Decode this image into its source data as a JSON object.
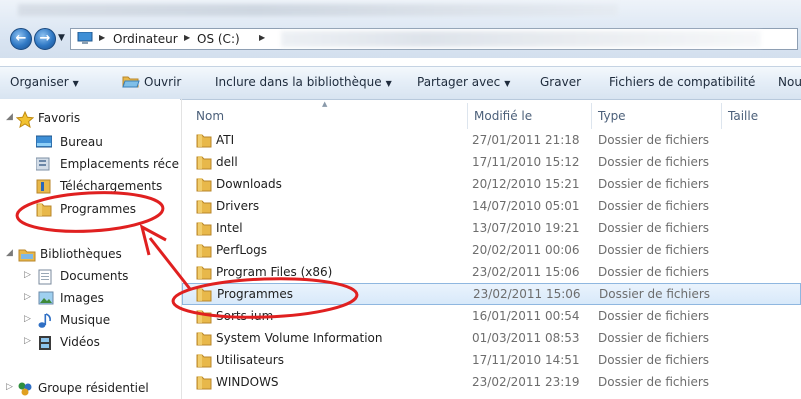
{
  "address": {
    "crumbs": [
      "Ordinateur",
      "OS (C:)"
    ]
  },
  "toolbar": {
    "organize": "Organiser",
    "open": "Ouvrir",
    "include": "Inclure dans la bibliothèque",
    "share": "Partager avec",
    "burn": "Graver",
    "compat": "Fichiers de compatibilité",
    "new_partial": "Nou"
  },
  "nav": {
    "favorites_label": "Favoris",
    "favorites": [
      {
        "label": "Bureau",
        "icon": "desktop-icon"
      },
      {
        "label": "Emplacements réce",
        "icon": "recent-places-icon"
      },
      {
        "label": "Téléchargements",
        "icon": "downloads-icon"
      },
      {
        "label": "Programmes",
        "icon": "folder-icon"
      }
    ],
    "libraries_label": "Bibliothèques",
    "libraries": [
      {
        "label": "Documents",
        "icon": "documents-icon"
      },
      {
        "label": "Images",
        "icon": "images-icon"
      },
      {
        "label": "Musique",
        "icon": "music-icon"
      },
      {
        "label": "Vidéos",
        "icon": "videos-icon"
      }
    ],
    "homegroup_label": "Groupe résidentiel"
  },
  "columns": {
    "name": "Nom",
    "modified": "Modifié le",
    "type": "Type",
    "size": "Taille"
  },
  "files": [
    {
      "name": "ATI",
      "date": "27/01/2011 21:18",
      "type": "Dossier de fichiers"
    },
    {
      "name": "dell",
      "date": "17/11/2010 15:12",
      "type": "Dossier de fichiers"
    },
    {
      "name": "Downloads",
      "date": "20/12/2010 15:21",
      "type": "Dossier de fichiers"
    },
    {
      "name": "Drivers",
      "date": "14/07/2010 05:01",
      "type": "Dossier de fichiers"
    },
    {
      "name": "Intel",
      "date": "13/07/2010 19:21",
      "type": "Dossier de fichiers"
    },
    {
      "name": "PerfLogs",
      "date": "20/02/2011 00:06",
      "type": "Dossier de fichiers"
    },
    {
      "name": "Program Files (x86)",
      "date": "23/02/2011 15:06",
      "type": "Dossier de fichiers"
    },
    {
      "name": "Programmes",
      "date": "23/02/2011 15:06",
      "type": "Dossier de fichiers"
    },
    {
      "name": "Sorts ium",
      "date": "16/01/2011 00:54",
      "type": "Dossier de fichiers"
    },
    {
      "name": "System Volume Information",
      "date": "01/03/2011 08:53",
      "type": "Dossier de fichiers"
    },
    {
      "name": "Utilisateurs",
      "date": "17/11/2010 14:51",
      "type": "Dossier de fichiers"
    },
    {
      "name": "WINDOWS",
      "date": "23/02/2011 23:19",
      "type": "Dossier de fichiers"
    }
  ],
  "colors": {
    "folder": "#e8b84a",
    "selection": "#d8e9fa",
    "annotation": "#e02020"
  }
}
